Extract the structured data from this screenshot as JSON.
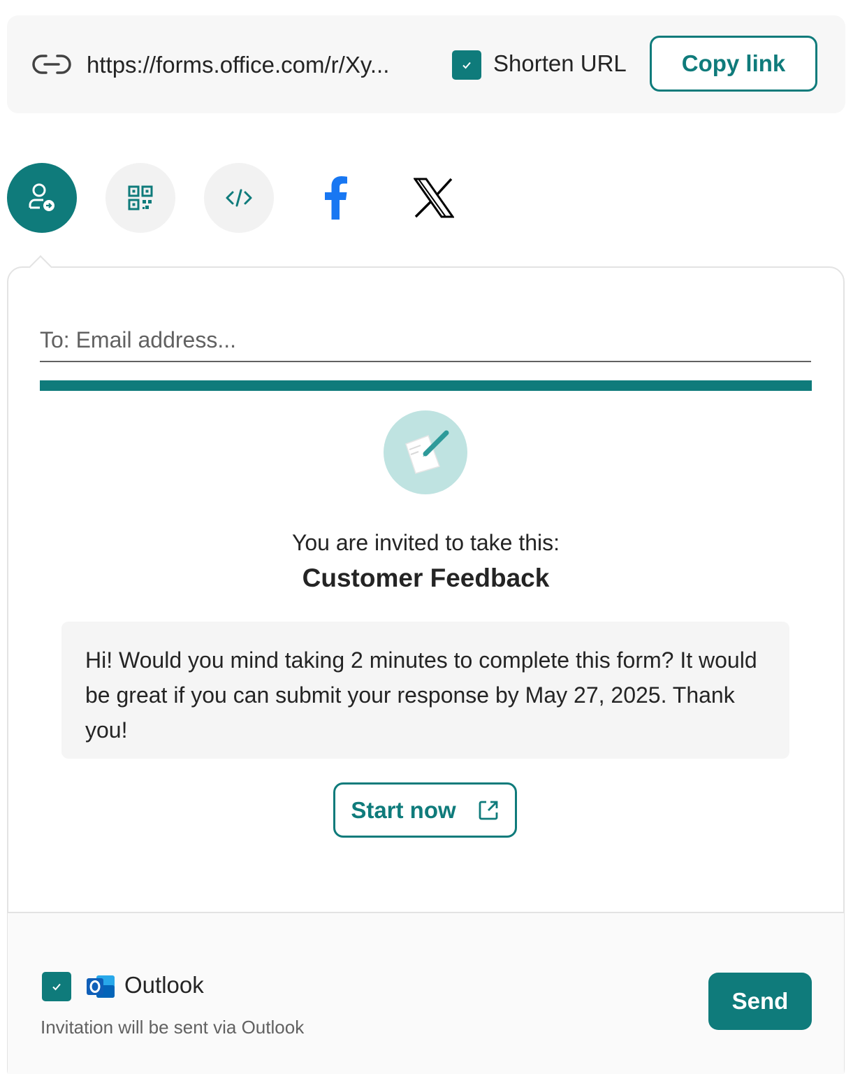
{
  "link_bar": {
    "url": "https://forms.office.com/r/Xy...",
    "shorten_label": "Shorten URL",
    "shorten_checked": true,
    "copy_label": "Copy link"
  },
  "share_options": [
    {
      "icon": "invite-person-icon",
      "selected": true
    },
    {
      "icon": "qr-code-icon",
      "selected": false
    },
    {
      "icon": "embed-code-icon",
      "selected": false
    },
    {
      "icon": "facebook-icon",
      "selected": false
    },
    {
      "icon": "x-icon",
      "selected": false
    }
  ],
  "email": {
    "to_placeholder": "To: Email address...",
    "invite_text": "You are invited to take this:",
    "form_title": "Customer Feedback",
    "message": "Hi! Would you mind taking 2 minutes to complete this form? It would be great if you can submit your response by May 27, 2025. Thank you!",
    "start_label": "Start now"
  },
  "footer": {
    "outlook_label": "Outlook",
    "outlook_checked": true,
    "hint": "Invitation will be sent via Outlook",
    "send_label": "Send"
  },
  "colors": {
    "accent": "#0f7b7b",
    "facebook": "#1877f2"
  }
}
